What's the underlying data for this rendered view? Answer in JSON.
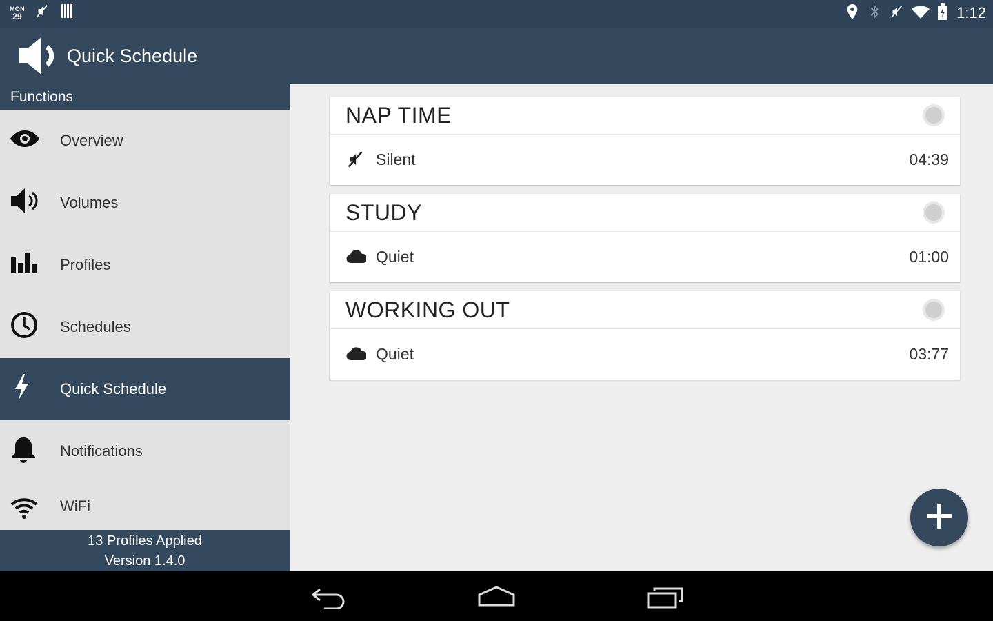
{
  "status_bar": {
    "day_of_week": "MON",
    "day": "29",
    "time": "1:12",
    "icons": [
      "muted-icon",
      "barcode-icon",
      "location-icon",
      "bluetooth-icon",
      "muted-icon",
      "wifi-icon",
      "battery-charging-icon"
    ]
  },
  "app_bar": {
    "title": "Quick Schedule",
    "logo_icon": "speaker-icon"
  },
  "drawer": {
    "header": "Functions",
    "items": [
      {
        "label": "Overview",
        "icon": "eye-icon"
      },
      {
        "label": "Volumes",
        "icon": "speaker-volume-icon"
      },
      {
        "label": "Profiles",
        "icon": "bar-chart-icon"
      },
      {
        "label": "Schedules",
        "icon": "clock-icon"
      },
      {
        "label": "Quick Schedule",
        "icon": "lightning-icon",
        "active": true
      },
      {
        "label": "Notifications",
        "icon": "bell-icon"
      },
      {
        "label": "WiFi",
        "icon": "wifi-icon"
      }
    ],
    "footer_line1": "13 Profiles Applied",
    "footer_line2": "Version 1.4.0"
  },
  "cards": [
    {
      "title": "NAP TIME",
      "profile": "Silent",
      "profile_icon": "muted-icon",
      "duration": "04:39"
    },
    {
      "title": "STUDY",
      "profile": "Quiet",
      "profile_icon": "cloud-icon",
      "duration": "01:00"
    },
    {
      "title": "WORKING OUT",
      "profile": "Quiet",
      "profile_icon": "cloud-icon",
      "duration": "03:77"
    }
  ],
  "fab": {
    "icon": "plus-icon"
  },
  "nav_bar": {
    "icons": [
      "back-icon",
      "home-icon",
      "recents-icon"
    ]
  },
  "colors": {
    "primary": "#35495e",
    "status_bar": "#2f4459",
    "drawer_bg": "#e2e2e2",
    "content_bg": "#eeeeee"
  }
}
